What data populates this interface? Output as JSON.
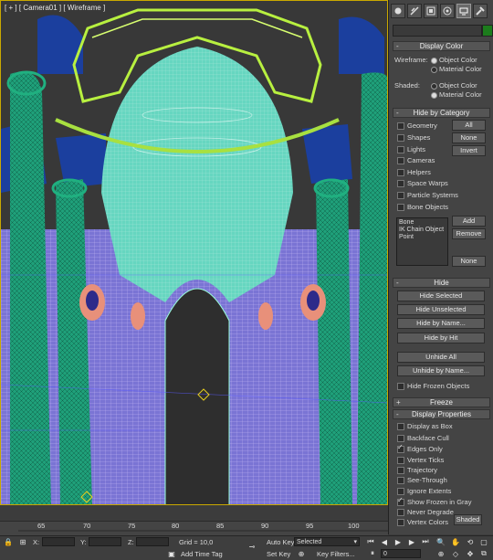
{
  "viewport": {
    "label_parts": [
      "[",
      "+",
      "]",
      "[",
      "Camera01",
      "]",
      "[",
      "Wireframe",
      "]"
    ]
  },
  "panel": {
    "tabs": [
      {
        "name": "create-tab-icon"
      },
      {
        "name": "modify-tab-icon"
      },
      {
        "name": "hierarchy-tab-icon"
      },
      {
        "name": "motion-tab-icon"
      },
      {
        "name": "display-tab-icon"
      },
      {
        "name": "utilities-tab-icon"
      }
    ],
    "object_color": "#1c7c1c",
    "display_color": {
      "title": "Display Color",
      "wireframe_label": "Wireframe:",
      "shaded_label": "Shaded:",
      "object_color": "Object Color",
      "material_color": "Material Color"
    },
    "hide_by_category": {
      "title": "Hide by Category",
      "items": [
        "Geometry",
        "Shapes",
        "Lights",
        "Cameras",
        "Helpers",
        "Space Warps",
        "Particle Systems",
        "Bone Objects"
      ],
      "all": "All",
      "none": "None",
      "invert": "Invert",
      "list": [
        "Bone",
        "IK Chain Object",
        "Point"
      ],
      "add": "Add",
      "remove": "Remove",
      "none2": "None"
    },
    "hide": {
      "title": "Hide",
      "buttons": [
        "Hide Selected",
        "Hide Unselected",
        "Hide by Name...",
        "Hide by Hit",
        "Unhide All",
        "Unhide by Name..."
      ],
      "hide_frozen": "Hide Frozen Objects"
    },
    "freeze": {
      "title": "Freeze",
      "sign": "+"
    },
    "display_properties": {
      "title": "Display Properties",
      "sign": "-",
      "items": [
        {
          "label": "Display as Box",
          "on": false
        },
        {
          "label": "Backface Cull",
          "on": false
        },
        {
          "label": "Edges Only",
          "on": true
        },
        {
          "label": "Vertex Ticks",
          "on": false
        },
        {
          "label": "Trajectory",
          "on": false
        },
        {
          "label": "See-Through",
          "on": false
        },
        {
          "label": "Ignore Extents",
          "on": false
        },
        {
          "label": "Show Frozen in Gray",
          "on": true
        },
        {
          "label": "Never Degrade",
          "on": false
        },
        {
          "label": "Vertex Colors",
          "on": false
        }
      ],
      "shaded": "Shaded"
    }
  },
  "timeline": {
    "ticks": [
      "65",
      "70",
      "75",
      "80",
      "85",
      "90",
      "95",
      "100"
    ]
  },
  "status": {
    "x_label": "X:",
    "y_label": "Y:",
    "z_label": "Z:",
    "grid": "Grid = 10,0",
    "auto_key": "Auto Key",
    "selected": "Selected",
    "set_key": "Set Key",
    "key_filters": "Key Filters...",
    "add_time_tag": "Add Time Tag",
    "frame": "0"
  }
}
